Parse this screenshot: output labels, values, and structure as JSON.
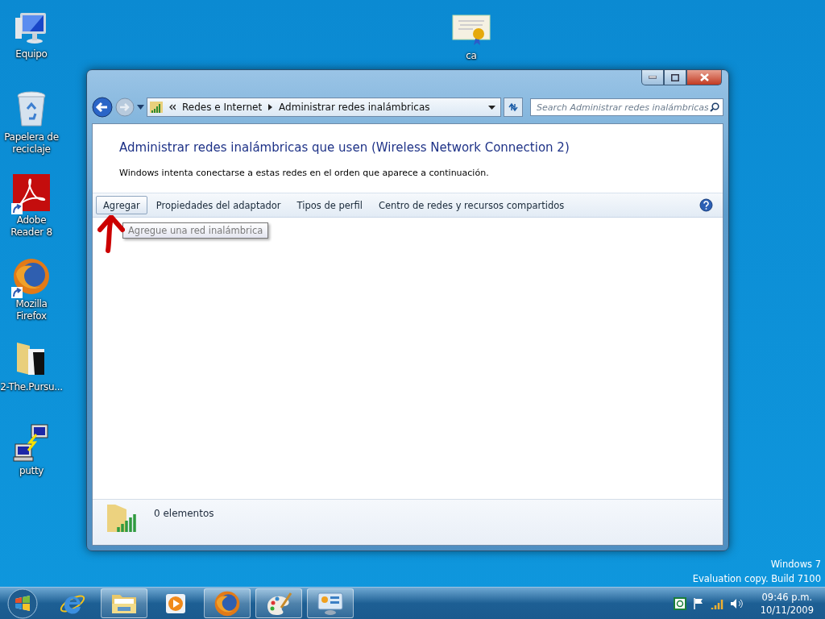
{
  "desktop_icons": [
    {
      "label": "Equipo",
      "kind": "computer"
    },
    {
      "label": "Papelera de reciclaje",
      "kind": "recycle"
    },
    {
      "label": "Adobe Reader 8",
      "kind": "pdf",
      "shortcut": true
    },
    {
      "label": "Mozilla Firefox",
      "kind": "browser",
      "shortcut": true
    },
    {
      "label": "2-The.Pursu...",
      "kind": "folder"
    },
    {
      "label": "putty",
      "kind": "terminal"
    },
    {
      "label": "ca",
      "kind": "certificate"
    }
  ],
  "window": {
    "breadcrumb": [
      "Redes e Internet",
      "Administrar redes inalámbricas"
    ],
    "search": {
      "placeholder": "Search Administrar redes inalámbricas"
    },
    "heading": "Administrar redes inalámbricas que usen (Wireless Network Connection 2)",
    "description": "Windows intenta conectarse a estas redes en el orden que aparece a continuación.",
    "toolbar": [
      {
        "label": "Agregar",
        "selected": true
      },
      {
        "label": "Propiedades del adaptador",
        "selected": false
      },
      {
        "label": "Tipos de perfil",
        "selected": false
      },
      {
        "label": "Centro de redes y recursos compartidos",
        "selected": false
      }
    ],
    "tooltip": "Agregue una red inalámbrica",
    "status": "0 elementos"
  },
  "watermark": [
    "Windows 7",
    "Evaluation copy. Build 7100"
  ],
  "taskbar": {
    "items": [
      {
        "kind": "ie",
        "selected": false
      },
      {
        "kind": "explorer",
        "selected": true
      },
      {
        "kind": "media",
        "selected": false
      },
      {
        "kind": "browser",
        "selected": true
      },
      {
        "kind": "paint",
        "selected": true
      },
      {
        "kind": "control",
        "selected": true
      }
    ],
    "time": "09:46 p.m.",
    "date": "10/11/2009"
  }
}
